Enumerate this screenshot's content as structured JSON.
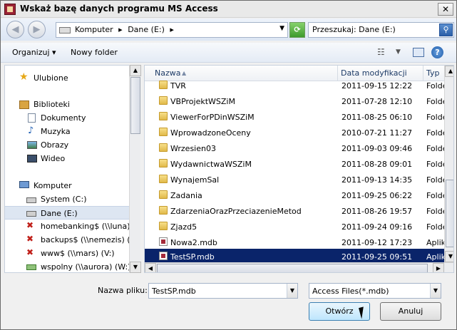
{
  "window": {
    "title": "Wskaż bazę danych programu MS Access",
    "close": "✕"
  },
  "nav": {
    "back": "◀",
    "forward": "▶",
    "breadcrumbs": [
      "Komputer",
      "▸",
      "Dane (E:)",
      "▸"
    ],
    "search_placeholder": "Przeszukaj: Dane (E:)"
  },
  "toolbar": {
    "organize": "Organizuj",
    "organize_arrow": "▾",
    "new_folder": "Nowy folder",
    "help": "?"
  },
  "sidebar": {
    "items": [
      {
        "label": "Ulubione",
        "icon": "star-icon"
      },
      {
        "label": "Biblioteki",
        "icon": "library-icon"
      },
      {
        "label": "Dokumenty",
        "icon": "documents-icon"
      },
      {
        "label": "Muzyka",
        "icon": "music-icon"
      },
      {
        "label": "Obrazy",
        "icon": "pictures-icon"
      },
      {
        "label": "Wideo",
        "icon": "video-icon"
      },
      {
        "label": "Komputer",
        "icon": "computer-icon"
      },
      {
        "label": "System (C:)",
        "icon": "drive-icon"
      },
      {
        "label": "Dane (E:)",
        "icon": "drive-icon"
      },
      {
        "label": "homebanking$ (\\\\luna) (H:",
        "icon": "network-drive-disconnected-icon"
      },
      {
        "label": "backups$ (\\\\nemezis) (U:)",
        "icon": "network-drive-disconnected-icon"
      },
      {
        "label": "www$ (\\\\mars) (V:)",
        "icon": "network-drive-disconnected-icon"
      },
      {
        "label": "wspolny (\\\\aurora) (W:)",
        "icon": "network-drive-icon"
      }
    ]
  },
  "files": {
    "columns": {
      "name": "Nazwa",
      "date": "Data modyfikacji",
      "type": "Typ"
    },
    "rows": [
      {
        "name": "TVR",
        "date": "2011-09-15 12:22",
        "type": "Folde",
        "kind": "folder"
      },
      {
        "name": "VBProjektWSZiM",
        "date": "2011-07-28 12:10",
        "type": "Folde",
        "kind": "folder"
      },
      {
        "name": "ViewerForPDinWSZiM",
        "date": "2011-08-25 06:10",
        "type": "Folde",
        "kind": "folder"
      },
      {
        "name": "WprowadzoneOceny",
        "date": "2010-07-21 11:27",
        "type": "Folde",
        "kind": "folder"
      },
      {
        "name": "Wrzesien03",
        "date": "2011-09-03 09:46",
        "type": "Folde",
        "kind": "folder"
      },
      {
        "name": "WydawnictwaWSZiM",
        "date": "2011-08-28 09:01",
        "type": "Folde",
        "kind": "folder"
      },
      {
        "name": "WynajemSal",
        "date": "2011-09-13 14:35",
        "type": "Folde",
        "kind": "folder"
      },
      {
        "name": "Zadania",
        "date": "2011-09-25 06:22",
        "type": "Folde",
        "kind": "folder"
      },
      {
        "name": "ZdarzeniaOrazPrzeciazenieMetod",
        "date": "2011-08-26 19:57",
        "type": "Folde",
        "kind": "folder"
      },
      {
        "name": "Zjazd5",
        "date": "2011-09-24 09:16",
        "type": "Folde",
        "kind": "folder"
      },
      {
        "name": "Nowa2.mdb",
        "date": "2011-09-12 17:23",
        "type": "Aplika",
        "kind": "mdb"
      },
      {
        "name": "TestSP.mdb",
        "date": "2011-09-25 09:51",
        "type": "Aplika",
        "kind": "mdb",
        "selected": true
      }
    ]
  },
  "bottom": {
    "filename_label": "Nazwa pliku:",
    "filename_value": "TestSP.mdb",
    "filter_value": "Access Files(*.mdb)",
    "open_label": "Otwórz",
    "cancel_label": "Anuluj"
  }
}
